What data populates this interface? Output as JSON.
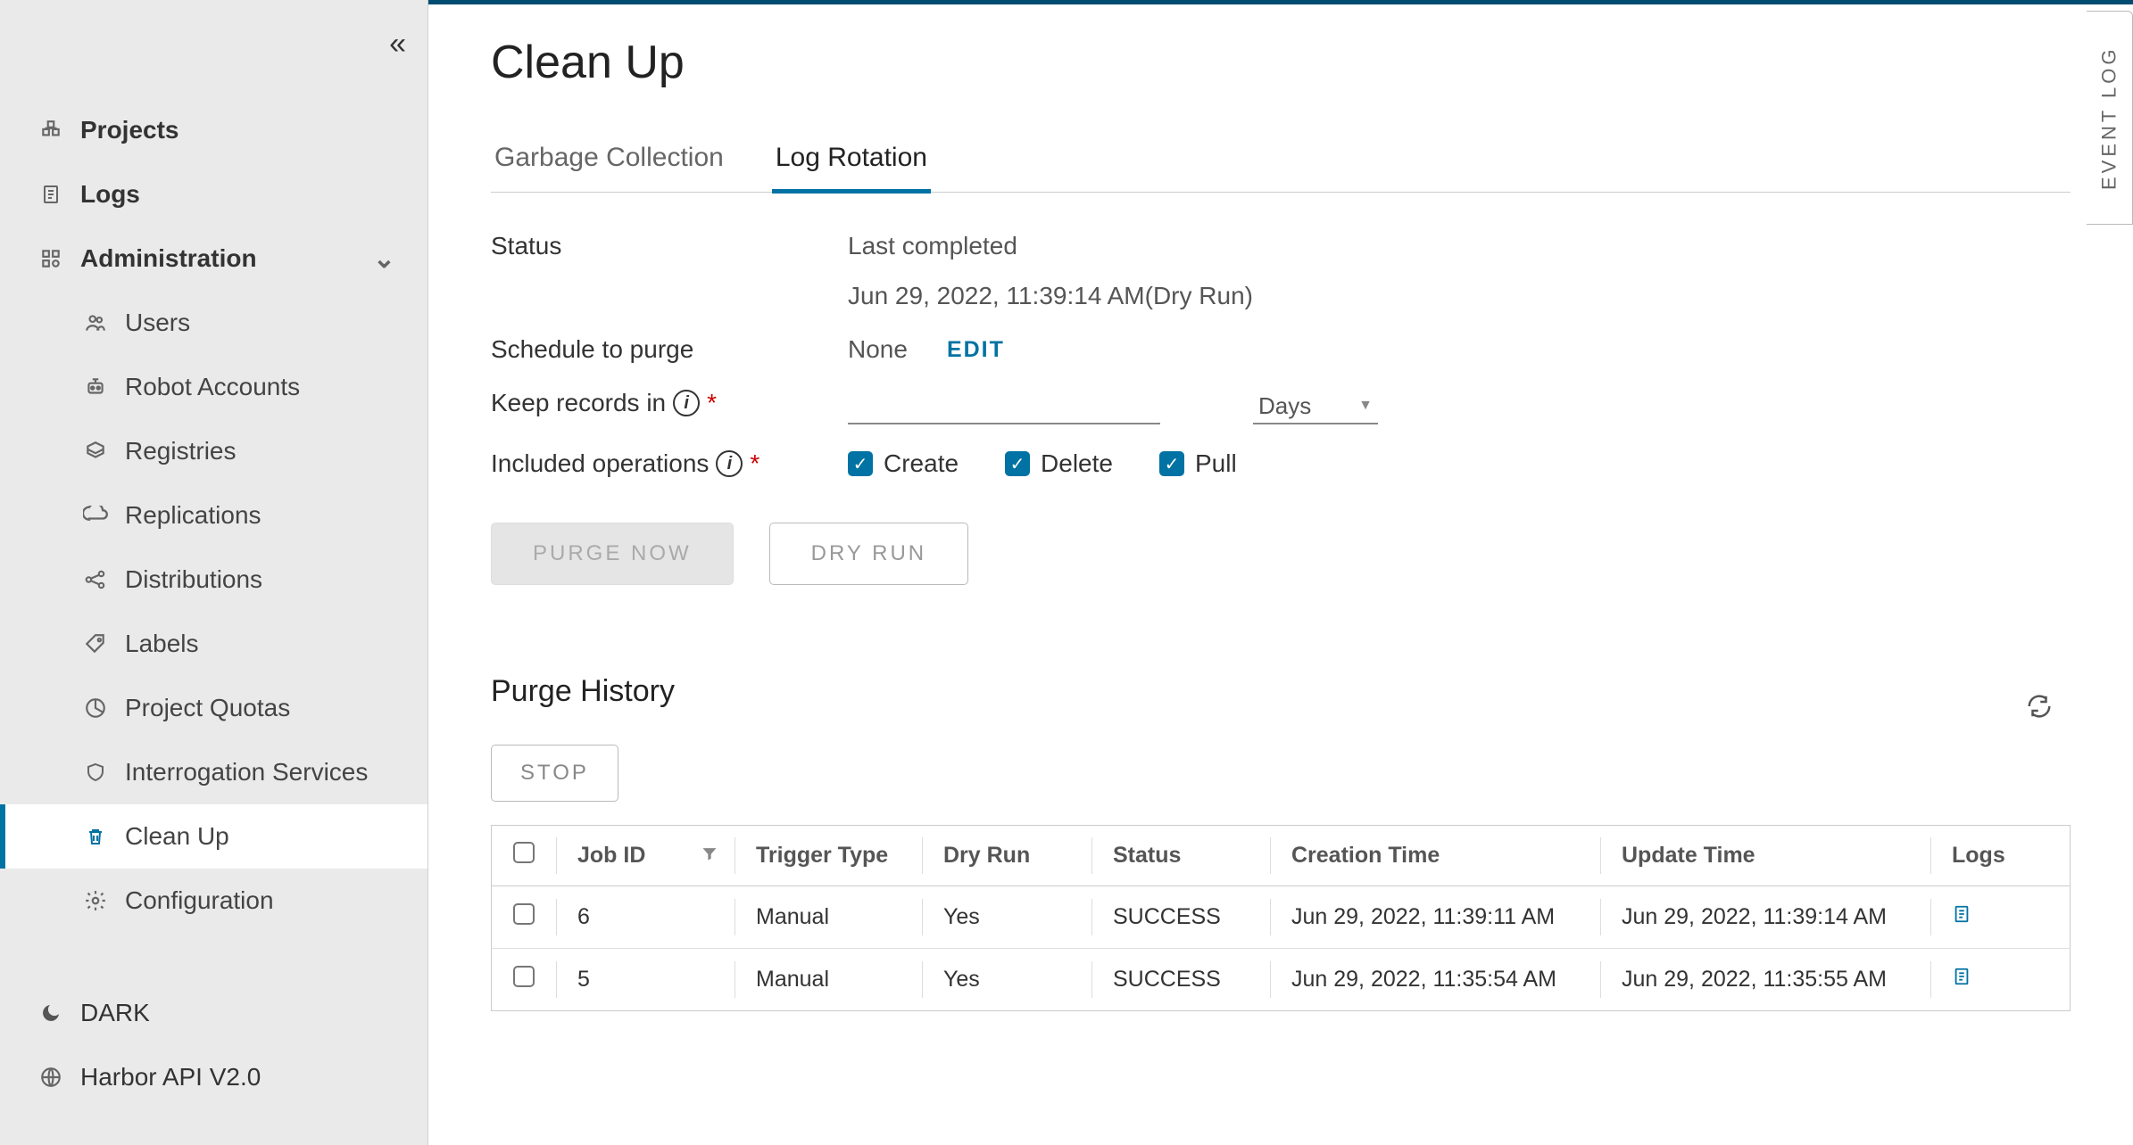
{
  "sidebar": {
    "items": {
      "projects": "Projects",
      "logs": "Logs",
      "administration": "Administration",
      "users": "Users",
      "robot": "Robot Accounts",
      "registries": "Registries",
      "replications": "Replications",
      "distributions": "Distributions",
      "labels": "Labels",
      "quotas": "Project Quotas",
      "interrogation": "Interrogation Services",
      "cleanup": "Clean Up",
      "configuration": "Configuration"
    },
    "bottom": {
      "dark": "DARK",
      "api": "Harbor API V2.0"
    }
  },
  "page": {
    "title": "Clean Up",
    "tabs": {
      "gc": "Garbage Collection",
      "logrot": "Log Rotation"
    },
    "event_log": "EVENT LOG"
  },
  "form": {
    "status_label": "Status",
    "status_value_1": "Last completed",
    "status_value_2": "Jun 29, 2022, 11:39:14 AM(Dry Run)",
    "schedule_label": "Schedule to purge",
    "schedule_value": "None",
    "edit": "EDIT",
    "keep_label": "Keep records in",
    "keep_unit": "Days",
    "ops_label": "Included operations",
    "ops": {
      "create": "Create",
      "delete": "Delete",
      "pull": "Pull"
    },
    "purge_now": "PURGE NOW",
    "dry_run": "DRY RUN"
  },
  "history": {
    "title": "Purge History",
    "stop": "STOP",
    "headers": {
      "job_id": "Job ID",
      "trigger": "Trigger Type",
      "dry_run": "Dry Run",
      "status": "Status",
      "creation": "Creation Time",
      "update": "Update Time",
      "logs": "Logs"
    },
    "rows": [
      {
        "id": "6",
        "trigger": "Manual",
        "dry_run": "Yes",
        "status": "SUCCESS",
        "created": "Jun 29, 2022, 11:39:11 AM",
        "updated": "Jun 29, 2022, 11:39:14 AM"
      },
      {
        "id": "5",
        "trigger": "Manual",
        "dry_run": "Yes",
        "status": "SUCCESS",
        "created": "Jun 29, 2022, 11:35:54 AM",
        "updated": "Jun 29, 2022, 11:35:55 AM"
      }
    ]
  }
}
